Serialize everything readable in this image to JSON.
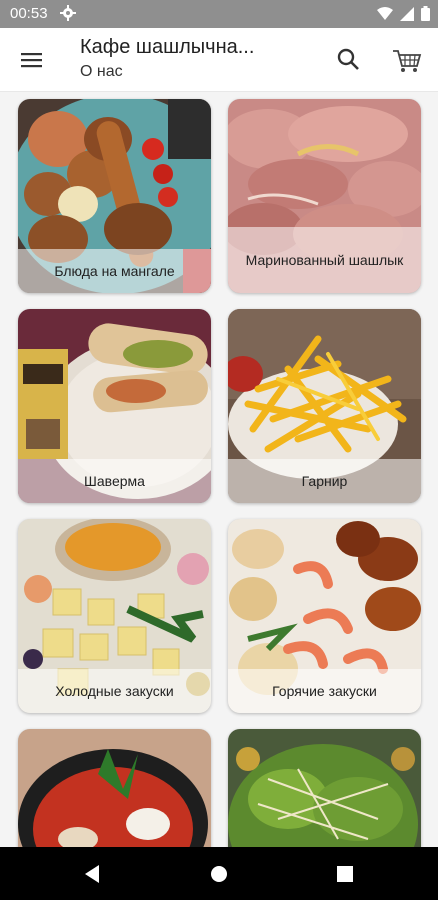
{
  "status_bar": {
    "time": "00:53",
    "icons": [
      "settings-gear-icon",
      "wifi-icon",
      "signal-icon",
      "battery-icon"
    ]
  },
  "app_bar": {
    "title": "Кафе шашлычна...",
    "subtitle": "О нас",
    "icons": [
      "menu-icon",
      "search-icon",
      "cart-icon"
    ]
  },
  "categories": [
    {
      "label": "Блюда на мангале"
    },
    {
      "label": "Маринованный шашлык"
    },
    {
      "label": "Шаверма"
    },
    {
      "label": "Гарнир"
    },
    {
      "label": "Холодные закуски"
    },
    {
      "label": "Горячие закуски"
    },
    {
      "label": ""
    },
    {
      "label": ""
    }
  ],
  "nav_bar": {
    "icons": [
      "back-icon",
      "home-icon",
      "recents-icon"
    ]
  },
  "colors": {
    "status_bar": "#8f8f8f",
    "nav_bar": "#000000",
    "label_overlay": "rgba(255,255,255,0.55)"
  }
}
